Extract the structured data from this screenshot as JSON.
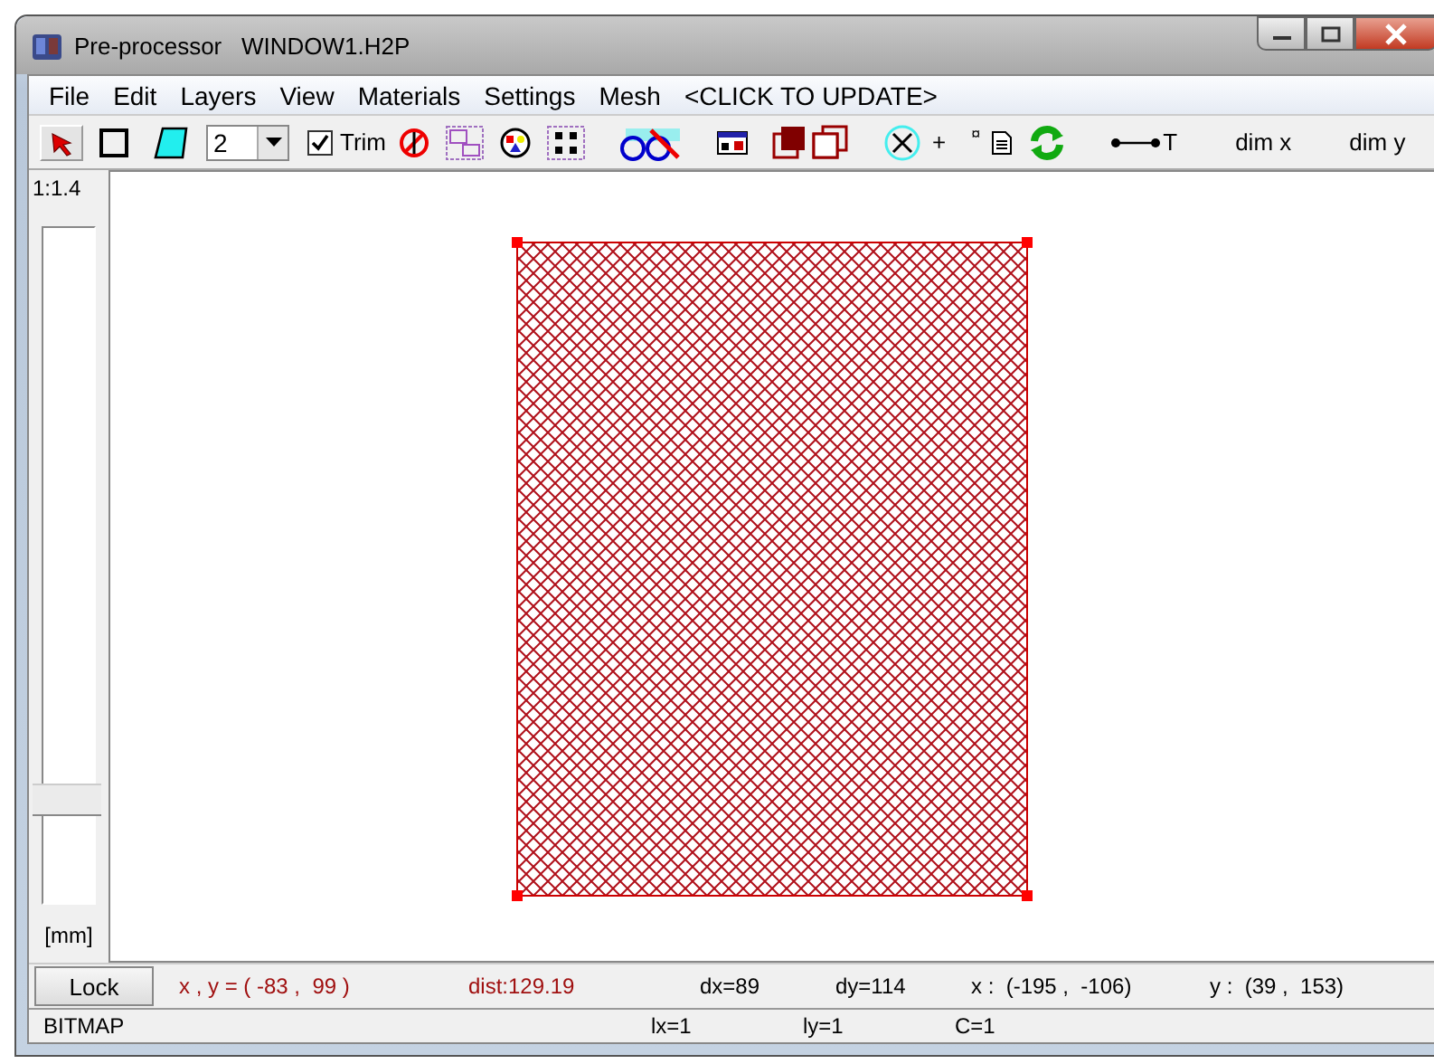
{
  "window": {
    "title": "Pre-processor   WINDOW1.H2P"
  },
  "menu": [
    {
      "label": "File"
    },
    {
      "label": "Edit"
    },
    {
      "label": "Layers"
    },
    {
      "label": "View"
    },
    {
      "label": "Materials"
    },
    {
      "label": "Settings"
    },
    {
      "label": "Mesh"
    },
    {
      "label": "<CLICK TO UPDATE>"
    }
  ],
  "toolbar": {
    "layer_select": {
      "value": "2"
    },
    "trim": {
      "label": "Trim",
      "checked": true
    },
    "plus_label": "+",
    "small_label": "¤",
    "measure_label": "T",
    "dim_labels": [
      "dim x",
      "dim y"
    ]
  },
  "scale_panel": {
    "ratio": "1:1.4",
    "zoom_slider": {
      "level": 0.15
    },
    "unit": "[mm]"
  },
  "status_bar": {
    "lock_button": "Lock",
    "coords": "x , y = ( -83 ,  99 )",
    "dist": "dist:129.19",
    "dx": "dx=89",
    "dy": "dy=114",
    "x_range": "x :  (-195 ,  -106)",
    "y_range": "y :  (39 ,  153)",
    "mode": "BITMAP",
    "lx": "lx=1",
    "ly": "ly=1",
    "c": "C=1"
  }
}
